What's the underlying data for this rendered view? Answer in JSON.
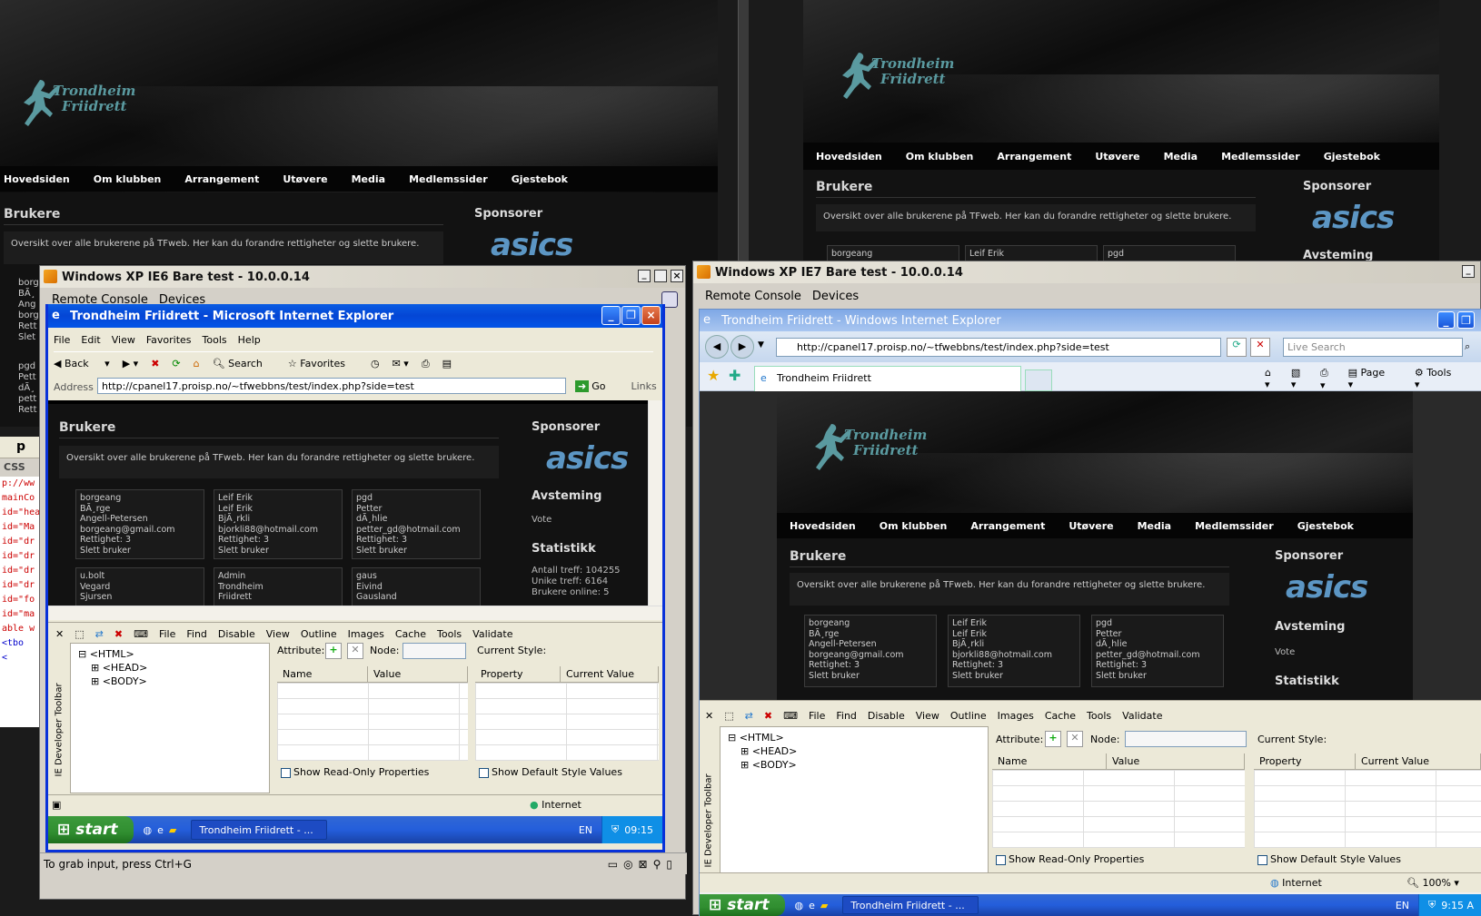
{
  "site": {
    "logo_line1": "Trondheim",
    "logo_line2": "Friidrett",
    "nav": [
      "Hovedsiden",
      "Om klubben",
      "Arrangement",
      "Utøvere",
      "Media",
      "Medlemssider",
      "Gjestebok"
    ],
    "title": "Brukere",
    "intro": "Oversikt over alle brukerene på TFweb. Her kan du forandre rettigheter og slette brukere.",
    "sponsor_title": "Sponsorer",
    "sponsor_brand": "asics",
    "vote_title": "Avsteming",
    "vote_label": "Vote",
    "stats_title": "Statistikk",
    "stats": [
      "Antall treff: 104255",
      "Unike treff: 6164",
      "Brukere online: 5"
    ],
    "users_row1": [
      [
        "borgeang",
        "BÃ¸rge",
        "Angell-Petersen",
        "borgeang@gmail.com",
        "Rettighet: 3",
        "Slett bruker"
      ],
      [
        "Leif Erik",
        "Leif Erik",
        "BjÃ¸rkli",
        "bjorkli88@hotmail.com",
        "Rettighet: 3",
        "Slett bruker"
      ],
      [
        "pgd",
        "Petter",
        "dÃ¸hlie",
        "petter_gd@hotmail.com",
        "Rettighet: 3",
        "Slett bruker"
      ]
    ],
    "users_row2": [
      [
        "u.bolt",
        "Vegard",
        "Sjursen"
      ],
      [
        "Admin",
        "Trondheim",
        "Friidrett"
      ],
      [
        "gaus",
        "Eivind",
        "Gausland"
      ]
    ]
  },
  "bg_left_partial": [
    "borg",
    "BÃ¸",
    "Ang",
    "borg",
    "Rett",
    "Slet",
    "pgd",
    "Pett",
    "dÃ¸",
    "pett",
    "Rett"
  ],
  "bg_editor": {
    "tab": "p",
    "css_label": "CSS",
    "lines": [
      "p://ww",
      "",
      "mainCo",
      "id=\"hea",
      "id=\"Ma",
      "id=\"dr",
      "id=\"dr",
      "id=\"dr",
      "id=\"dr",
      "id=\"fo",
      "id=\"ma",
      "able w",
      "<tbo",
      "<"
    ]
  },
  "vm1": {
    "title": "Windows XP IE6 Bare test - 10.0.0.14",
    "menu": [
      "Remote Console",
      "Devices"
    ],
    "ie_title": "Trondheim Friidrett - Microsoft Internet Explorer",
    "ie_menu": [
      "File",
      "Edit",
      "View",
      "Favorites",
      "Tools",
      "Help"
    ],
    "toolbar": {
      "back": "Back",
      "search": "Search",
      "favorites": "Favorites"
    },
    "address_label": "Address",
    "url": "http://cpanel17.proisp.no/~tfwebbns/test/index.php?side=test",
    "go": "Go",
    "links": "Links",
    "status_zone": "Internet",
    "grab_hint": "To grab input, press Ctrl+G",
    "clock": "09:15",
    "lang": "EN",
    "taskitem": "Trondheim Friidrett - ..."
  },
  "vm2": {
    "title": "Windows XP IE7 Bare test - 10.0.0.14",
    "menu": [
      "Remote Console",
      "Devices"
    ],
    "ie_title": "Trondheim Friidrett - Windows Internet Explorer",
    "url": "http://cpanel17.proisp.no/~tfwebbns/test/index.php?side=test",
    "search_placeholder": "Live Search",
    "tab_label": "Trondheim Friidrett",
    "page_label": "Page",
    "tools_label": "Tools",
    "status_zone": "Internet",
    "zoom": "100%",
    "clock": "9:15 A",
    "lang": "EN",
    "taskitem": "Trondheim Friidrett - ..."
  },
  "devtools": {
    "menu": [
      "File",
      "Find",
      "Disable",
      "View",
      "Outline",
      "Images",
      "Cache",
      "Tools",
      "Validate"
    ],
    "tree": [
      "<HTML>",
      "<HEAD>",
      "<BODY>"
    ],
    "attribute_label": "Attribute:",
    "node_label": "Node:",
    "current_style": "Current Style:",
    "cols_attr": [
      "Name",
      "Value"
    ],
    "cols_style": [
      "Property",
      "Current Value"
    ],
    "readonly": "Show Read-Only Properties",
    "default_style": "Show Default Style Values",
    "side_label": "IE Developer Toolbar"
  },
  "colors": {
    "xp_blue": "#0a5ce3",
    "xp_green": "#3c9a3c",
    "teal_logo": "#5a9aa0",
    "asics_blue": "#5c96c4"
  }
}
